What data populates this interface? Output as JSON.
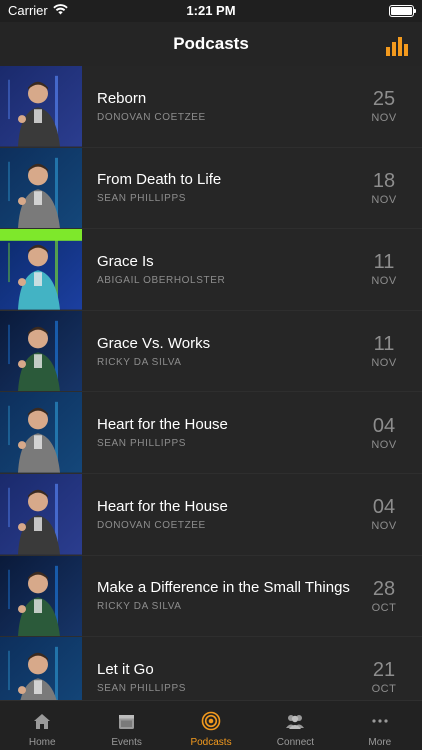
{
  "status_bar": {
    "carrier": "Carrier",
    "time": "1:21 PM"
  },
  "nav": {
    "title": "Podcasts",
    "action_icon": "bar-chart-icon"
  },
  "colors": {
    "accent": "#f39a1e",
    "background": "#1c1c1c",
    "row": "#262626",
    "muted": "#8d8d8d"
  },
  "podcasts": [
    {
      "title": "Reborn",
      "speaker": "DONOVAN COETZEE",
      "day": "25",
      "month": "NOV"
    },
    {
      "title": "From Death to Life",
      "speaker": "SEAN PHILLIPPS",
      "day": "18",
      "month": "NOV"
    },
    {
      "title": "Grace Is",
      "speaker": "ABIGAIL OBERHOLSTER",
      "day": "11",
      "month": "NOV"
    },
    {
      "title": "Grace Vs. Works",
      "speaker": "RICKY DA SILVA",
      "day": "11",
      "month": "NOV"
    },
    {
      "title": "Heart for the House",
      "speaker": "SEAN PHILLIPPS",
      "day": "04",
      "month": "NOV"
    },
    {
      "title": "Heart for the House",
      "speaker": "DONOVAN COETZEE",
      "day": "04",
      "month": "NOV"
    },
    {
      "title": "Make a Difference in the Small Things",
      "speaker": "RICKY DA SILVA",
      "day": "28",
      "month": "OCT"
    },
    {
      "title": "Let it Go",
      "speaker": "SEAN PHILLIPPS",
      "day": "21",
      "month": "OCT"
    }
  ],
  "tabs": [
    {
      "label": "Home",
      "icon": "home-icon"
    },
    {
      "label": "Events",
      "icon": "calendar-icon"
    },
    {
      "label": "Podcasts",
      "icon": "podcast-icon"
    },
    {
      "label": "Connect",
      "icon": "people-icon"
    },
    {
      "label": "More",
      "icon": "more-icon"
    }
  ]
}
